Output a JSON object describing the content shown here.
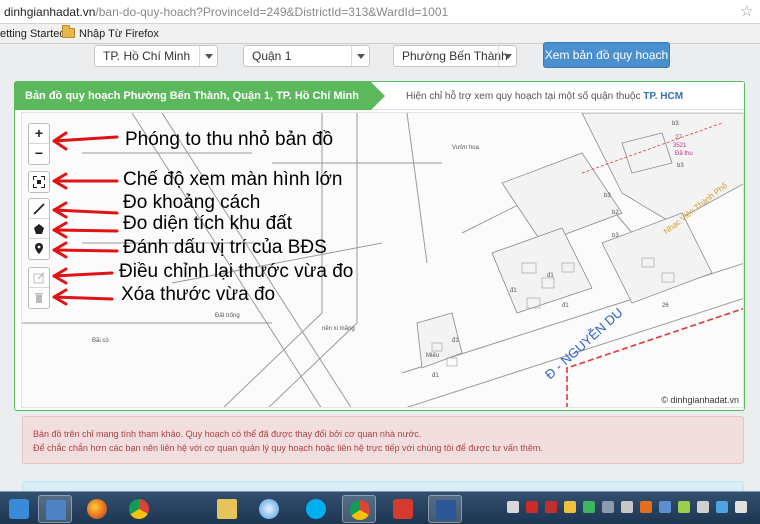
{
  "browser": {
    "url_host": "dinhgianhadat.vn",
    "url_path": "/ban-do-quy-hoach?ProvinceId=249&DistrictId=313&WardId=1001",
    "bookmarks": [
      "etting Started",
      "Nhập Từ Firefox"
    ]
  },
  "filters": {
    "city": "TP. Hồ Chí Minh",
    "district": "Quận 1",
    "ward": "Phường Bến Thành",
    "view_button": "Xem bản đồ quy hoạch"
  },
  "map_panel": {
    "title": "Bản đồ quy hoạch Phường Bến Thành, Quận 1, TP. Hồ Chí Minh",
    "support_text": "Hiện chỉ hỗ trợ xem quy hoạch tại một số quận thuộc",
    "support_city": "TP. HCM",
    "attribution": "© dinhgianhadat.vn"
  },
  "map_controls": {
    "zoom_in": "+",
    "zoom_out": "−",
    "icons": [
      "fullscreen-icon",
      "ruler-icon",
      "polygon-icon",
      "marker-icon",
      "edit-icon",
      "trash-icon"
    ]
  },
  "annotations": {
    "zoom": "Phóng to thu nhỏ bản đồ",
    "fullscreen": "Chế độ xem màn hình lớn",
    "distance": "Đo khoảng cách",
    "area": "Đo diện tích khu đất",
    "marker": "Đánh dấu vị trí của BĐS",
    "edit": "Điều chỉnh lại thước vừa đo",
    "delete": "Xóa thước vừa đo"
  },
  "map_labels": {
    "street": "Đ - NGUYỄN DU",
    "nhac_vien": "Nhạc Viện Thành Phố",
    "vuon_hoa": "Vườn hoa",
    "dat_trong": "Đất trống",
    "nen_si_mang": "nền xi măng",
    "mieu": "Miếu",
    "bai_co": "Bãi cỏ",
    "plots": [
      "b3",
      "27",
      "3521",
      "Đã thu",
      "b3",
      "b2",
      "b3",
      "b3",
      "đ1",
      "đ1",
      "đ1",
      "đ1",
      "đ1",
      "26"
    ]
  },
  "notice": {
    "line1": "Bản đồ trên chỉ mang tính tham khảo. Quy hoạch có thể đã được thay đổi bởi cơ quan nhà nước.",
    "line2": "Để chắc chắn hơn các bạn nên liên hệ với cơ quan quản lý quy hoạch hoặc liên hệ trực tiếp với chúng tôi để được tư vấn thêm."
  },
  "taskbar": {
    "apps": [
      "start-button",
      "explorer-icon",
      "firefox-icon",
      "chrome-icon",
      "folder-icon",
      "media-icon",
      "safari-icon",
      "skype-icon",
      "chrome-icon",
      "app-icon",
      "word-icon"
    ]
  },
  "colors": {
    "accent_green": "#5cb85c",
    "button_blue": "#4a90cf",
    "annotation_arrow": "#e01414",
    "street_blue": "#3060c8"
  }
}
